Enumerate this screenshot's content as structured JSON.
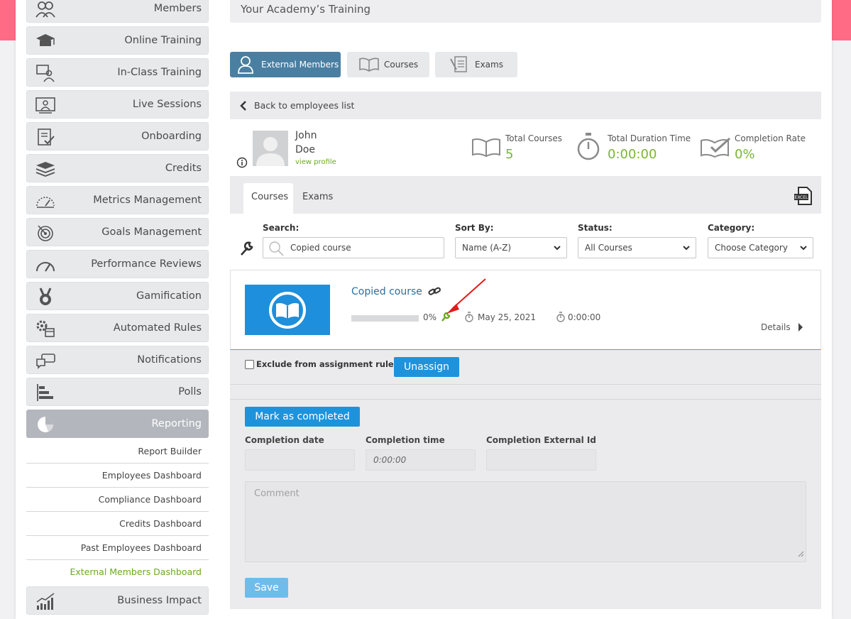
{
  "sidebar": {
    "items": [
      {
        "label": "Members",
        "icon": "members-icon"
      },
      {
        "label": "Online Training",
        "icon": "graduation-cap-icon"
      },
      {
        "label": "In-Class Training",
        "icon": "classroom-icon"
      },
      {
        "label": "Live Sessions",
        "icon": "live-session-icon"
      },
      {
        "label": "Onboarding",
        "icon": "clipboard-check-icon"
      },
      {
        "label": "Credits",
        "icon": "layers-icon"
      },
      {
        "label": "Metrics Management",
        "icon": "gauge-icon"
      },
      {
        "label": "Goals Management",
        "icon": "target-icon"
      },
      {
        "label": "Performance Reviews",
        "icon": "speedometer-icon"
      },
      {
        "label": "Gamification",
        "icon": "medal-icon"
      },
      {
        "label": "Automated Rules",
        "icon": "gear-calendar-icon"
      },
      {
        "label": "Notifications",
        "icon": "chat-bubbles-icon"
      },
      {
        "label": "Polls",
        "icon": "bar-chart-icon"
      },
      {
        "label": "Reporting",
        "icon": "pie-chart-icon"
      },
      {
        "label": "Business Impact",
        "icon": "trend-chart-icon"
      }
    ],
    "reporting_sub": [
      "Report Builder",
      "Employees Dashboard",
      "Compliance Dashboard",
      "Credits Dashboard",
      "Past Employees Dashboard",
      "External Members Dashboard"
    ]
  },
  "header": {
    "title": "Your Academy’s Training"
  },
  "tabs": {
    "external": "External Members",
    "courses": "Courses",
    "exams": "Exams"
  },
  "back": {
    "label": "Back to employees list"
  },
  "profile": {
    "first": "John",
    "last": "Doe",
    "link": "view profile"
  },
  "stats": {
    "total_courses_label": "Total Courses",
    "total_courses": "5",
    "duration_label": "Total Duration Time",
    "duration": "0:00:00",
    "completion_label": "Completion Rate",
    "completion": "0%"
  },
  "subtabs": {
    "courses": "Courses",
    "exams": "Exams"
  },
  "filters": {
    "search_label": "Search:",
    "search_value": "Copied course",
    "sort_label": "Sort By:",
    "sort_value": "Name (A-Z)",
    "status_label": "Status:",
    "status_value": "All Courses",
    "category_label": "Category:",
    "category_value": "Choose Category"
  },
  "course": {
    "title": "Copied course",
    "progress": 0,
    "progress_text": "0%",
    "date": "May 25, 2021",
    "duration": "0:00:00",
    "details": "Details"
  },
  "assignment": {
    "exclude_label": "Exclude from assignment rules",
    "unassign": "Unassign"
  },
  "completion": {
    "mark_button": "Mark as completed",
    "date_label": "Completion date",
    "time_label": "Completion time",
    "time_placeholder": "0:00:00",
    "ext_label": "Completion External Id",
    "comment_placeholder": "Comment",
    "save": "Save"
  },
  "colors": {
    "accent_green": "#7ab534",
    "primary_blue": "#1e93dc",
    "tab_active": "#4a7fa2",
    "pink": "#ff6b84"
  }
}
